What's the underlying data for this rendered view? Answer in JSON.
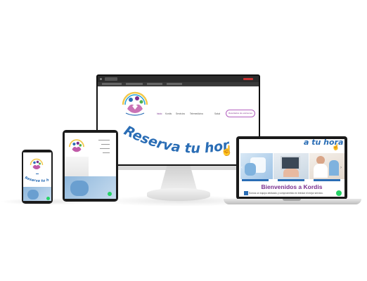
{
  "brand": {
    "colors": {
      "primary_blue": "#2a6db5",
      "purple": "#7a2f8e",
      "pink": "#c05aa8",
      "green": "#25d366",
      "yellow": "#f2c94c"
    }
  },
  "desktop": {
    "nav": {
      "items": [
        "Inicio",
        "Kordis",
        "Servicios",
        "Telemedicina",
        "Salud"
      ],
      "cta": "Resultados de exámenes"
    },
    "hero_title": "Reserva tu hora"
  },
  "laptop": {
    "hero_partial": "a tu hora",
    "welcome": "Bienvenidos a Kordis",
    "body": "Somos un equipo dedicado y comprometido en brindar el mejor servicio."
  },
  "phone": {
    "hero_title": "Reserva tu hora"
  },
  "icons": {
    "desktop_cursor": "hand-pointer-icon",
    "laptop_cursor": "hand-pointer-icon",
    "chat": "whatsapp-icon"
  }
}
